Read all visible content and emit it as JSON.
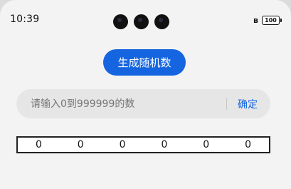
{
  "status_bar": {
    "time": "10:39",
    "battery": "100"
  },
  "generate_button": {
    "label": "生成随机数"
  },
  "input": {
    "placeholder": "请输入0到999999的数",
    "value": ""
  },
  "confirm_button": {
    "label": "确定"
  },
  "digits": [
    "0",
    "0",
    "0",
    "0",
    "0",
    "0"
  ],
  "colors": {
    "accent": "#1565e0",
    "background": "#f3f3f3",
    "input_background": "#e6e6e6"
  }
}
